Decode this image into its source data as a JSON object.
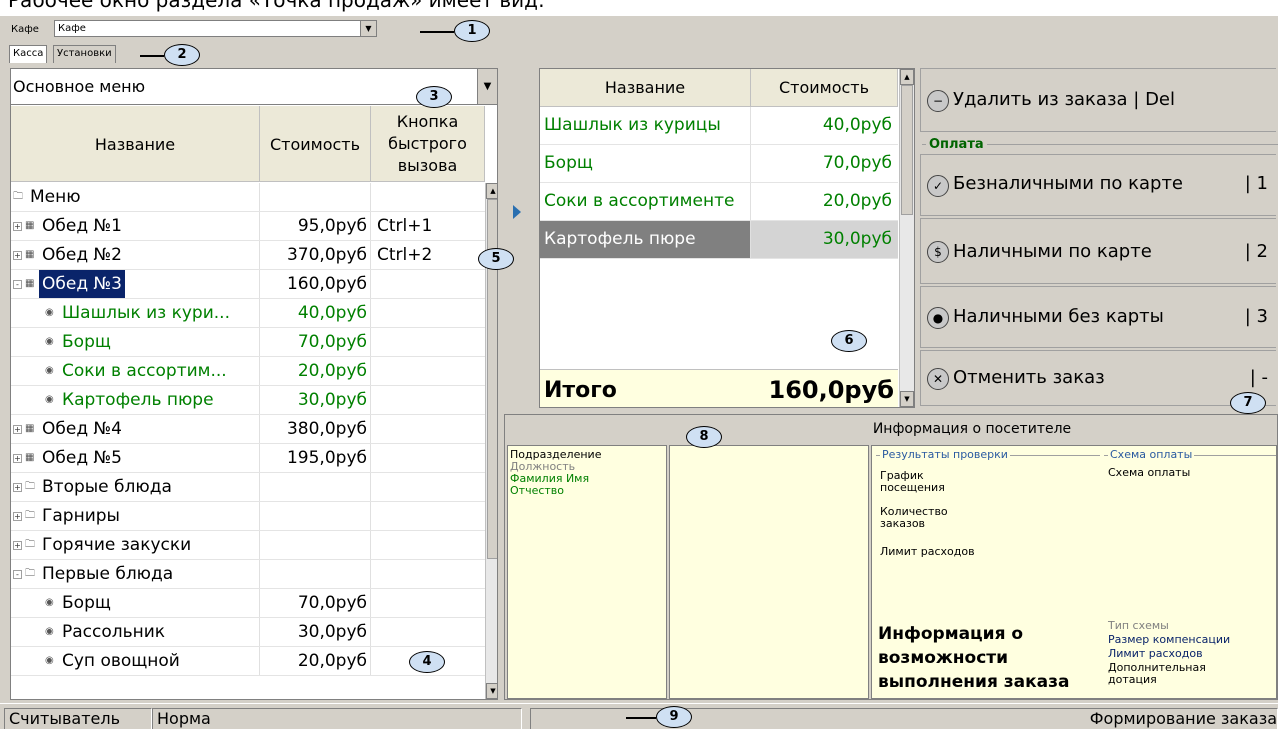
{
  "caption": "Рабочее окно раздела «Точка продаж» имеет вид:",
  "toolbar": {
    "cafe_label": "Кафе",
    "cafe_value": "Кафе"
  },
  "tabs": [
    "Касса",
    "Установки"
  ],
  "menu_select": "Основное меню",
  "left_table": {
    "headers": [
      "Название",
      "Стоимость",
      "Кнопка быстрого вызова"
    ],
    "rows": [
      {
        "name": "Меню",
        "price": "",
        "hotkey": ""
      },
      {
        "name": "Обед №1",
        "price": "95,0руб",
        "hotkey": "Ctrl+1"
      },
      {
        "name": "Обед №2",
        "price": "370,0руб",
        "hotkey": "Ctrl+2"
      },
      {
        "name": "Обед №3",
        "price": "160,0руб",
        "hotkey": ""
      },
      {
        "name": "Шашлык из кури...",
        "price": "40,0руб",
        "hotkey": ""
      },
      {
        "name": "Борщ",
        "price": "70,0руб",
        "hotkey": ""
      },
      {
        "name": "Соки в ассортим...",
        "price": "20,0руб",
        "hotkey": ""
      },
      {
        "name": "Картофель пюре",
        "price": "30,0руб",
        "hotkey": ""
      },
      {
        "name": "Обед №4",
        "price": "380,0руб",
        "hotkey": ""
      },
      {
        "name": "Обед №5",
        "price": "195,0руб",
        "hotkey": ""
      },
      {
        "name": "Вторые блюда",
        "price": "",
        "hotkey": ""
      },
      {
        "name": "Гарниры",
        "price": "",
        "hotkey": ""
      },
      {
        "name": "Горячие закуски",
        "price": "",
        "hotkey": ""
      },
      {
        "name": "Первые блюда",
        "price": "",
        "hotkey": ""
      },
      {
        "name": "Борщ",
        "price": "70,0руб",
        "hotkey": ""
      },
      {
        "name": "Рассольник",
        "price": "30,0руб",
        "hotkey": ""
      },
      {
        "name": "Суп овощной",
        "price": "20,0руб",
        "hotkey": ""
      }
    ]
  },
  "order_table": {
    "headers": [
      "Название",
      "Стоимость"
    ],
    "rows": [
      {
        "name": "Шашлык из курицы",
        "price": "40,0руб"
      },
      {
        "name": "Борщ",
        "price": "70,0руб"
      },
      {
        "name": "Соки в ассортименте",
        "price": "20,0руб"
      },
      {
        "name": "Картофель пюре",
        "price": "30,0руб"
      }
    ],
    "total_label": "Итого",
    "total_value": "160,0руб"
  },
  "actions": {
    "delete": {
      "label": "Удалить из заказа | Del"
    },
    "payment_group": "Оплата",
    "cashless": {
      "label": "Безналичными по карте",
      "key": "| 1"
    },
    "cash_card": {
      "label": "Наличными по карте",
      "key": "| 2"
    },
    "cash_nocard": {
      "label": "Наличными без карты",
      "key": "| 3"
    },
    "cancel": {
      "label": "Отменить заказ",
      "key": "| -"
    }
  },
  "visitor": {
    "title": "Информация о посетителе",
    "fields": [
      "Подразделение",
      "Должность",
      "Фамилия Имя",
      "Отчество"
    ],
    "check_group": "Результаты проверки",
    "check_items": [
      "График посещения",
      "Количество заказов",
      "Лимит расходов"
    ],
    "possibility": "Информация о возможности выполнения заказа",
    "scheme_group": "Схема оплаты",
    "scheme_value": "Схема оплаты",
    "scheme_items": [
      "Тип схемы",
      "Размер компенсации",
      "Лимит расходов",
      "Дополнительная дотация"
    ]
  },
  "status": {
    "reader": "Считыватель",
    "state": "Норма",
    "mode": "Формирование заказа"
  },
  "callouts": [
    "1",
    "2",
    "3",
    "4",
    "5",
    "6",
    "7",
    "8",
    "9"
  ]
}
